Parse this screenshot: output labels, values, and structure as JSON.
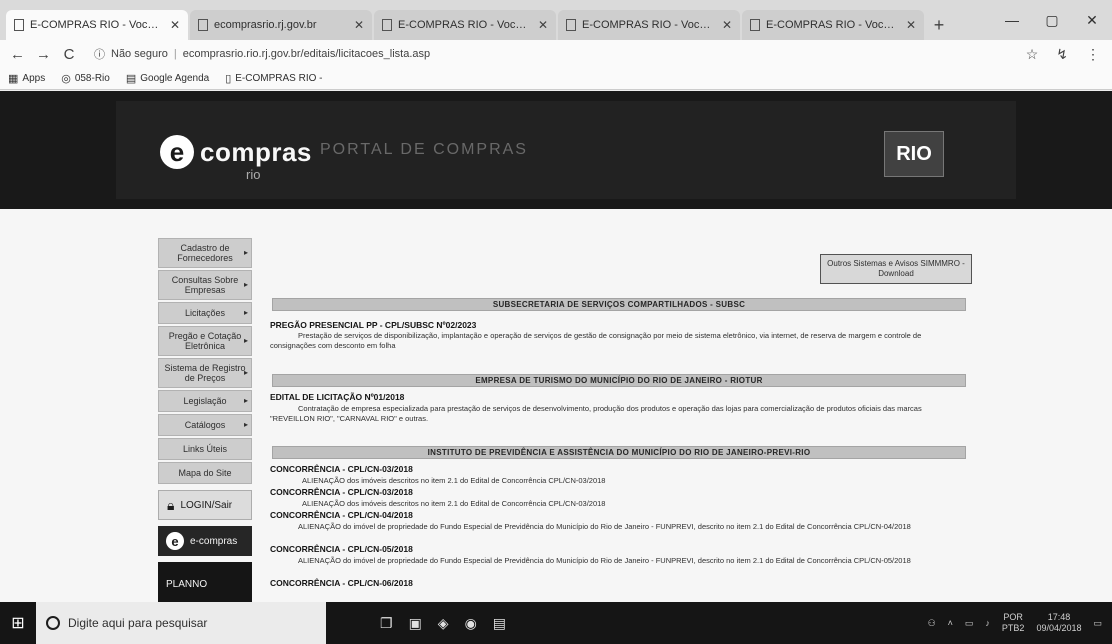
{
  "browser": {
    "tabs": [
      {
        "label": "E-COMPRAS RIO - Você ligad..",
        "active": true
      },
      {
        "label": "ecomprasrio.rj.gov.br"
      },
      {
        "label": "E-COMPRAS RIO - Você ligado"
      },
      {
        "label": "E-COMPRAS RIO - Você ligado"
      },
      {
        "label": "E-COMPRAS RIO - Você ligado"
      }
    ],
    "new_tab": "+",
    "window_controls": {
      "min": "—",
      "max": "▢",
      "close": "✕"
    },
    "nav": {
      "back": "←",
      "forward": "→",
      "reload": "C"
    },
    "security_label": "Não seguro",
    "url": "ecomprasrio.rio.rj.gov.br/editais/licitacoes_lista.asp",
    "bookmarks": [
      {
        "label": "Apps",
        "icon": "apps-icon"
      },
      {
        "label": "058-Rio",
        "icon": "globe-icon"
      },
      {
        "label": "Google Agenda",
        "icon": "calendar-icon"
      },
      {
        "label": "E-COMPRAS RIO -",
        "icon": "page-icon"
      }
    ]
  },
  "header": {
    "logo_text": "compras",
    "logo_letter": "e",
    "logo_sub": "rio",
    "portal_title": "PORTAL DE COMPRAS",
    "city_logo": "RIO"
  },
  "sidebar": {
    "items": [
      "Cadastro de Fornecedores",
      "Consultas Sobre Empresas",
      "Licitações",
      "Pregão e Cotação Eletrônica",
      "Sistema de Registro de Preços",
      "Legislação",
      "Catálogos",
      "Links Úteis",
      "Mapa do Site"
    ],
    "login_label": "LOGIN/Sair",
    "ecompras_label": "e-compras",
    "bottom_label": "PLANNO"
  },
  "content": {
    "top_button": "Outros Sistemas e Avisos SIMMMRO - Download",
    "sections": [
      {
        "header": "SUBSECRETARIA DE SERVIÇOS COMPARTILHADOS - SUBSC",
        "title": "PREGÃO PRESENCIAL PP - CPL/SUBSC Nº02/2023",
        "desc": "Prestação de serviços de disponibilização, implantação e operação de serviços de gestão de consignação por meio de sistema eletrônico, via internet, de reserva de margem e controle de consignações com desconto em folha"
      },
      {
        "header": "EMPRESA DE TURISMO DO MUNICÍPIO DO RIO DE JANEIRO - RIOTUR",
        "title": "EDITAL DE LICITAÇÃO Nº01/2018",
        "desc": "Contratação de empresa especializada para prestação de serviços de desenvolvimento, produção dos produtos e operação das lojas para comercialização de produtos oficiais das marcas \"REVEILLON RIO\", \"CARNAVAL RIO\" e outras."
      },
      {
        "header": "INSTITUTO DE PREVIDÊNCIA E ASSISTÊNCIA DO MUNICÍPIO DO RIO DE JANEIRO-PREVI-RIO",
        "items": [
          {
            "title": "CONCORRÊNCIA - CPL/CN-03/2018",
            "desc": "ALIENAÇÃO dos imóveis descritos no item 2.1 do Edital de Concorrência CPL/CN-03/2018"
          },
          {
            "title": "CONCORRÊNCIA - CPL/CN-03/2018",
            "desc": "ALIENAÇÃO dos imóveis descritos no item 2.1 do Edital de Concorrência CPL/CN-03/2018"
          },
          {
            "title": "CONCORRÊNCIA - CPL/CN-04/2018",
            "desc": "ALIENAÇÃO do imóvel de propriedade do Fundo Especial de Previdência do Município do Rio de Janeiro - FUNPREVI, descrito no item 2.1 do Edital de Concorrência CPL/CN-04/2018"
          },
          {
            "title": "CONCORRÊNCIA - CPL/CN-05/2018",
            "desc": "ALIENAÇÃO do imóvel de propriedade do Fundo Especial de Previdência do Município do Rio de Janeiro - FUNPREVI, descrito no item 2.1 do Edital de Concorrência CPL/CN-05/2018"
          },
          {
            "title": "CONCORRÊNCIA - CPL/CN-06/2018"
          }
        ]
      }
    ]
  },
  "taskbar": {
    "search_placeholder": "Digite aqui para pesquisar",
    "clock_time": "17:48",
    "clock_date": "09/04/2018",
    "language": "POR",
    "language_sub": "PTB2"
  }
}
